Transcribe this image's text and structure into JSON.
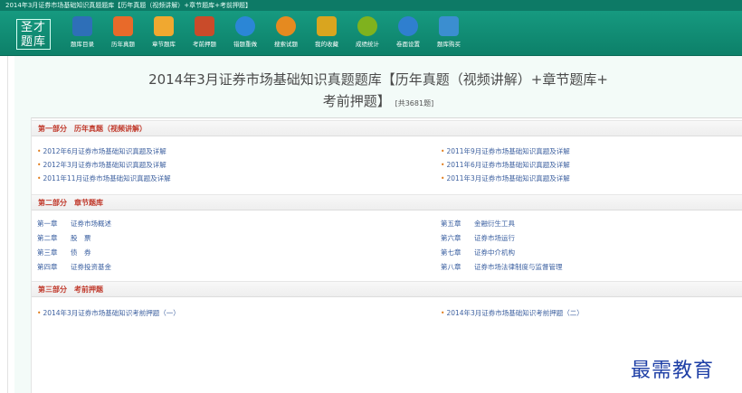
{
  "window": {
    "title": "2014年3月证券市场基础知识真题题库【历年真题（视频讲解）+章节题库+考前押题】"
  },
  "toolbar": {
    "logo_text": "圣才题库",
    "items": [
      {
        "label": "题库目录",
        "icon": "monitor-icon",
        "color": "#2e6fb8"
      },
      {
        "label": "历年真题",
        "icon": "document-icon",
        "color": "#e86a2a"
      },
      {
        "label": "章节题库",
        "icon": "pencil-note-icon",
        "color": "#f0a830"
      },
      {
        "label": "考前押题",
        "icon": "exam-sheet-icon",
        "color": "#c94b2a"
      },
      {
        "label": "错题重做",
        "icon": "redo-icon",
        "color": "#2b86d6"
      },
      {
        "label": "搜索试题",
        "icon": "search-icon",
        "color": "#e58a20"
      },
      {
        "label": "我的收藏",
        "icon": "bookmark-icon",
        "color": "#d9a51f"
      },
      {
        "label": "成绩统计",
        "icon": "chart-icon",
        "color": "#7fb21e"
      },
      {
        "label": "卷面设置",
        "icon": "gear-icon",
        "color": "#2f7fcf"
      },
      {
        "label": "题库购买",
        "icon": "shopping-icon",
        "color": "#3b8ed0"
      }
    ]
  },
  "heading": {
    "line1": "2014年3月证券市场基础知识真题题库【历年真题（视频讲解）+章节题库+",
    "line2": "考前押题】",
    "count": "[共3681题]"
  },
  "sections": [
    {
      "part": "第一部分",
      "name": "历年真题（视频讲解）",
      "left": [
        "2012年6月证券市场基础知识真题及详解",
        "2012年3月证券市场基础知识真题及详解",
        "2011年11月证券市场基础知识真题及详解"
      ],
      "right": [
        "2011年9月证券市场基础知识真题及详解",
        "2011年6月证券市场基础知识真题及详解",
        "2011年3月证券市场基础知识真题及详解"
      ]
    },
    {
      "part": "第二部分",
      "name": "章节题库",
      "left": [
        {
          "num": "第一章",
          "title": "证券市场概述"
        },
        {
          "num": "第二章",
          "title": "股　票"
        },
        {
          "num": "第三章",
          "title": "债　券"
        },
        {
          "num": "第四章",
          "title": "证券投资基金"
        }
      ],
      "right": [
        {
          "num": "第五章",
          "title": "金融衍生工具"
        },
        {
          "num": "第六章",
          "title": "证券市场运行"
        },
        {
          "num": "第七章",
          "title": "证券中介机构"
        },
        {
          "num": "第八章",
          "title": "证券市场法律制度与监督管理"
        }
      ]
    },
    {
      "part": "第三部分",
      "name": "考前押题",
      "left": [
        "2014年3月证券市场基础知识考前押题（一）"
      ],
      "right": [
        "2014年3月证券市场基础知识考前押题（二）"
      ]
    }
  ],
  "watermark": "最需教育"
}
